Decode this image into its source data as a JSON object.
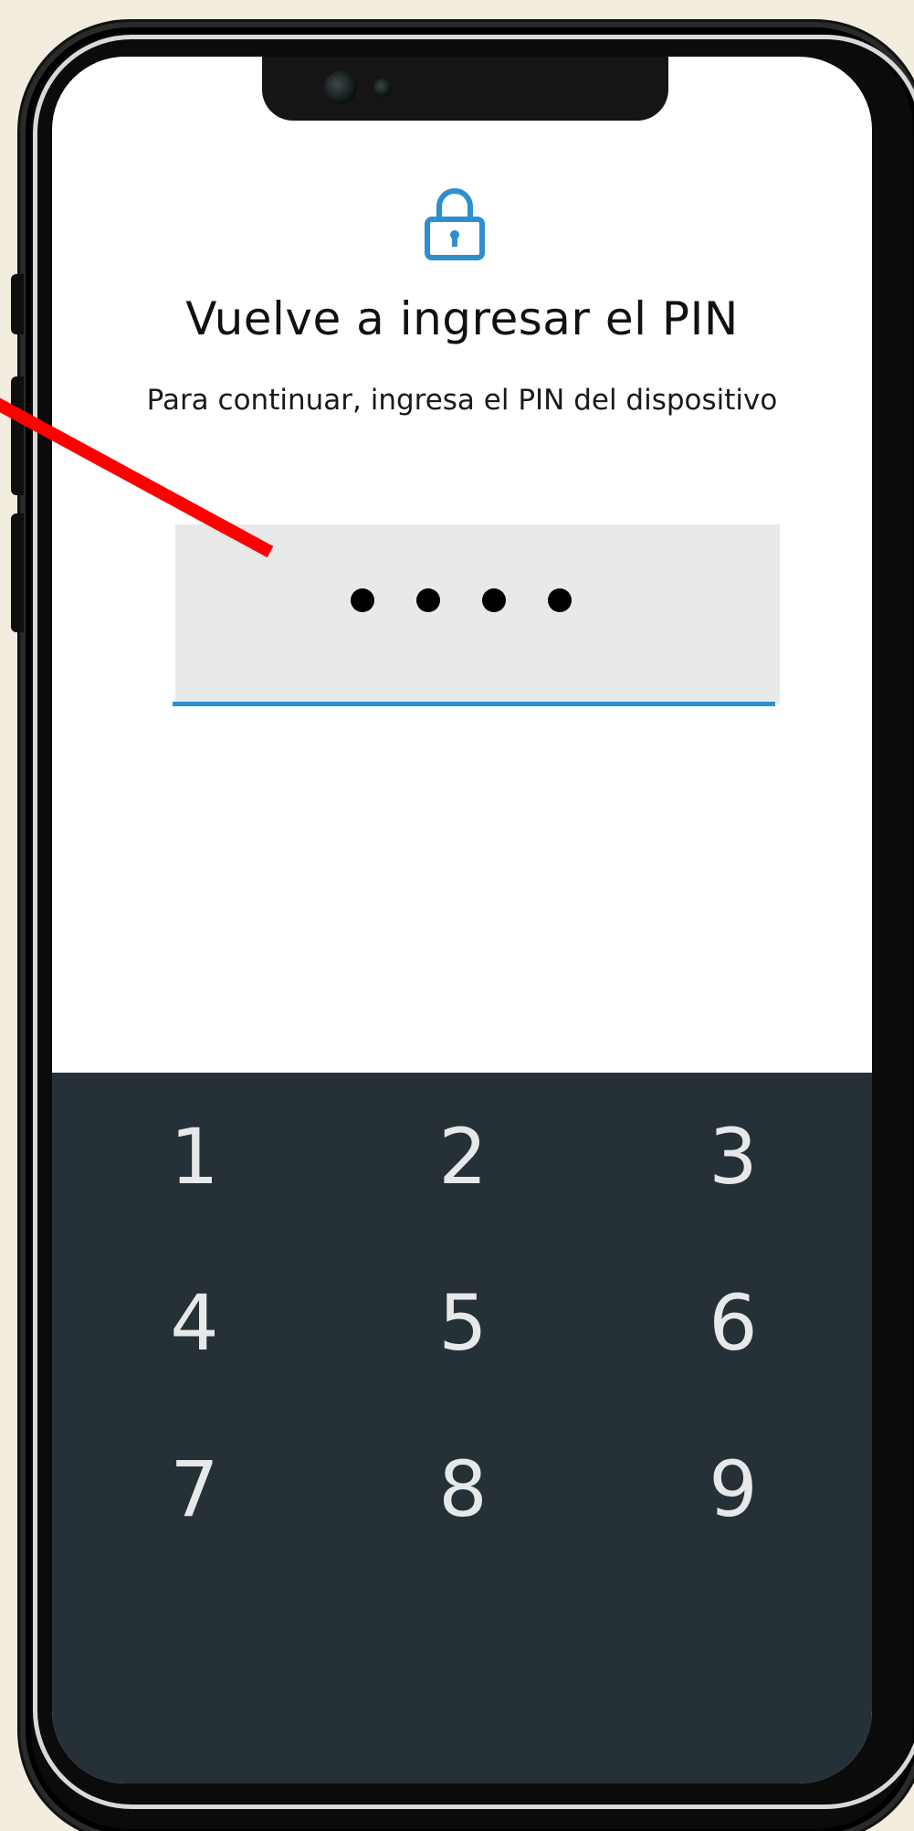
{
  "screen": {
    "title": "Vuelve a ingresar el PIN",
    "subtitle": "Para continuar, ingresa el PIN del dispositivo"
  },
  "pin_input": {
    "entered_digits_count": 4,
    "masked_value": "••••"
  },
  "keypad": {
    "keys": [
      "1",
      "2",
      "3",
      "4",
      "5",
      "6",
      "7",
      "8",
      "9"
    ]
  },
  "icons": {
    "lock": "lock-icon"
  },
  "colors": {
    "accent": "#2e8fcf",
    "keypad_bg": "#263037",
    "annotation": "#ff0000"
  }
}
